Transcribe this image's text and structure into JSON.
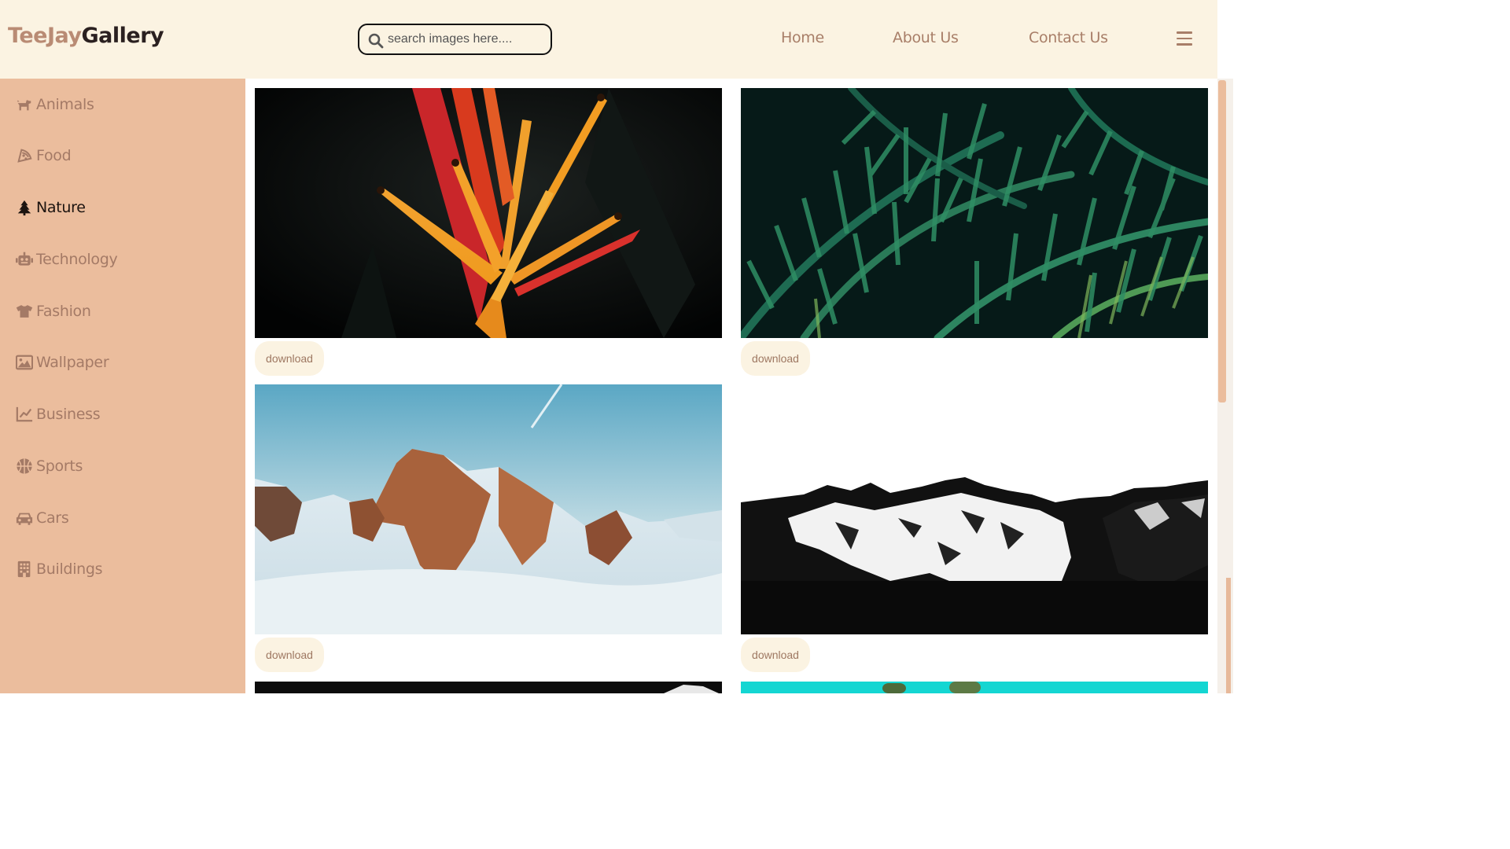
{
  "brand": {
    "part1": "TeeJay",
    "part2": "Gallery"
  },
  "search": {
    "placeholder": "search images here...."
  },
  "nav": {
    "home": "Home",
    "about": "About Us",
    "contact": "Contact Us"
  },
  "sidebar": {
    "items": [
      {
        "label": "Animals",
        "icon": "dog-icon",
        "active": false
      },
      {
        "label": "Food",
        "icon": "pizza-icon",
        "active": false
      },
      {
        "label": "Nature",
        "icon": "tree-icon",
        "active": true
      },
      {
        "label": "Technology",
        "icon": "robot-icon",
        "active": false
      },
      {
        "label": "Fashion",
        "icon": "shirt-icon",
        "active": false
      },
      {
        "label": "Wallpaper",
        "icon": "image-icon",
        "active": false
      },
      {
        "label": "Business",
        "icon": "chart-line-icon",
        "active": false
      },
      {
        "label": "Sports",
        "icon": "basketball-icon",
        "active": false
      },
      {
        "label": "Cars",
        "icon": "car-icon",
        "active": false
      },
      {
        "label": "Buildings",
        "icon": "building-icon",
        "active": false
      }
    ]
  },
  "gallery": {
    "download_label": "download",
    "photos": [
      {
        "subject": "bird-of-paradise-flower"
      },
      {
        "subject": "palm-leaves"
      },
      {
        "subject": "snowy-mountain-peaks"
      },
      {
        "subject": "black-white-mountain"
      },
      {
        "subject": "dark-partial"
      },
      {
        "subject": "cactus-partial"
      }
    ]
  },
  "colors": {
    "header_bg": "#fbf3e2",
    "sidebar_bg": "#ebbd9d",
    "accent_text": "#a87e68",
    "active_text": "#1c1410"
  }
}
